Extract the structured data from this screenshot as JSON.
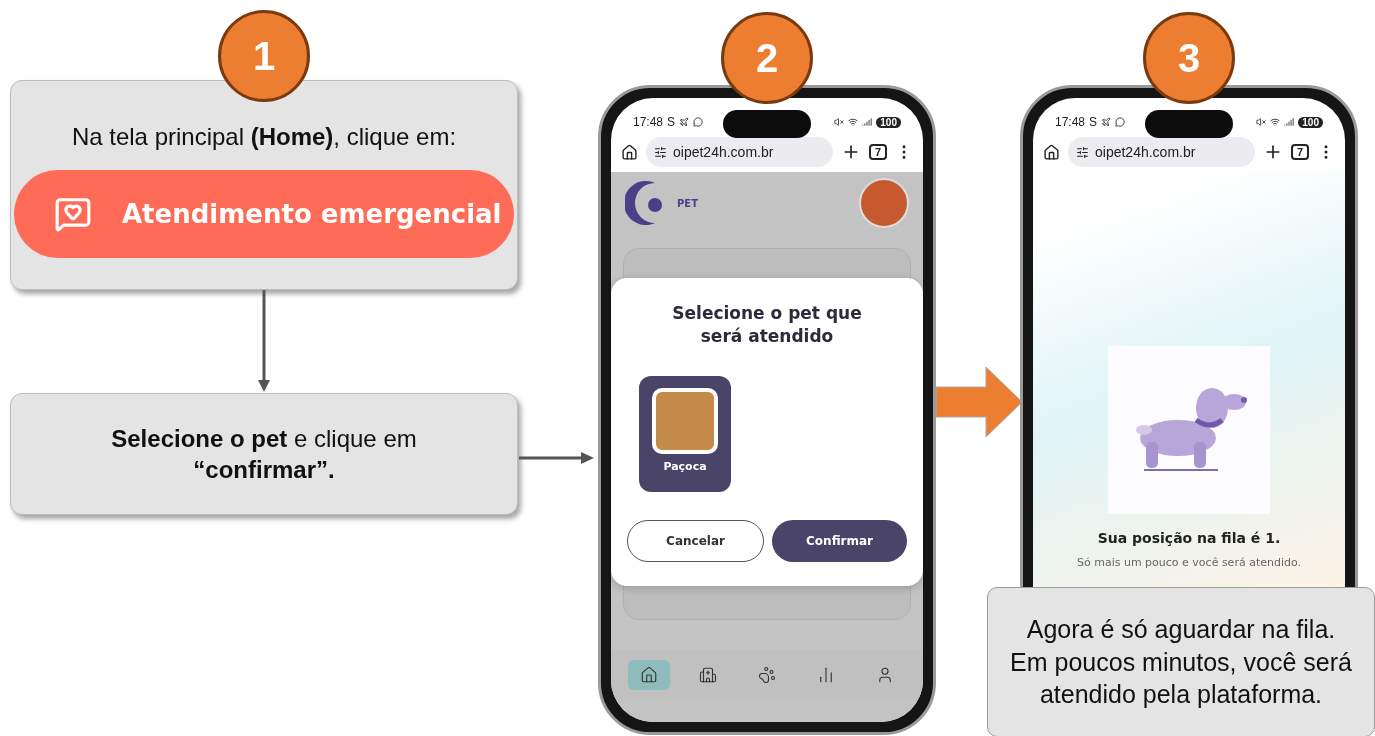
{
  "steps": [
    {
      "number": "1"
    },
    {
      "number": "2"
    },
    {
      "number": "3"
    }
  ],
  "step1": {
    "instruction": "Na tela principal **(Home)**, clique em:",
    "button": "Atendimento emergencial"
  },
  "step1b": {
    "instruction": "**Selecione o pet** e clique em **“confirmar”.**"
  },
  "phone2": {
    "status": {
      "time": "17:48",
      "app_letter": "S",
      "battery": "100"
    },
    "browser": {
      "url": "oipet24h.com.br",
      "tab_count": "7"
    },
    "logo_text": "PET",
    "modal": {
      "title": "Selecione o pet que será atendido",
      "pets": [
        {
          "name": "Paçoca",
          "selected": true
        }
      ],
      "buttons": [
        {
          "label": "Cancelar",
          "kind": "outline"
        },
        {
          "label": "Confirmar",
          "kind": "primary"
        }
      ]
    },
    "nav": [
      {
        "kind": "home",
        "selected": true
      },
      {
        "kind": "hospital",
        "selected": false
      },
      {
        "kind": "paw",
        "selected": false
      },
      {
        "kind": "chart",
        "selected": false
      },
      {
        "kind": "user",
        "selected": false
      }
    ]
  },
  "phone3": {
    "status": {
      "time": "17:48",
      "app_letter": "S",
      "battery": "100"
    },
    "browser": {
      "url": "oipet24h.com.br",
      "tab_count": "7"
    },
    "title": "Sua posição na fila é 1.",
    "subtitle": "Só mais um pouco e você será atendido."
  },
  "callout": {
    "lines": [
      "Agora é só aguardar na fila.",
      "Em poucos minutos, você será",
      "atendido pela plataforma."
    ]
  }
}
